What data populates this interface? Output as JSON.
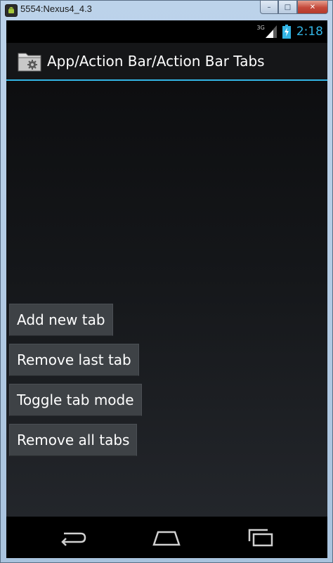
{
  "window": {
    "title": "5554:Nexus4_4.3",
    "controls": {
      "minimize": "–",
      "maximize": "□",
      "close": "✕"
    }
  },
  "statusbar": {
    "network_type": "3G",
    "clock": "2:18",
    "icons": [
      "signal-icon",
      "battery-charging-icon"
    ]
  },
  "actionbar": {
    "icon": "folder-gear-icon",
    "title": "App/Action Bar/Action Bar Tabs",
    "accent_color": "#33b5e5"
  },
  "buttons": {
    "add_new_tab": "Add new tab",
    "remove_last_tab": "Remove last tab",
    "toggle_tab_mode": "Toggle tab mode",
    "remove_all_tabs": "Remove all tabs"
  },
  "navbar": {
    "icons": [
      "back-icon",
      "home-icon",
      "recents-icon"
    ]
  }
}
